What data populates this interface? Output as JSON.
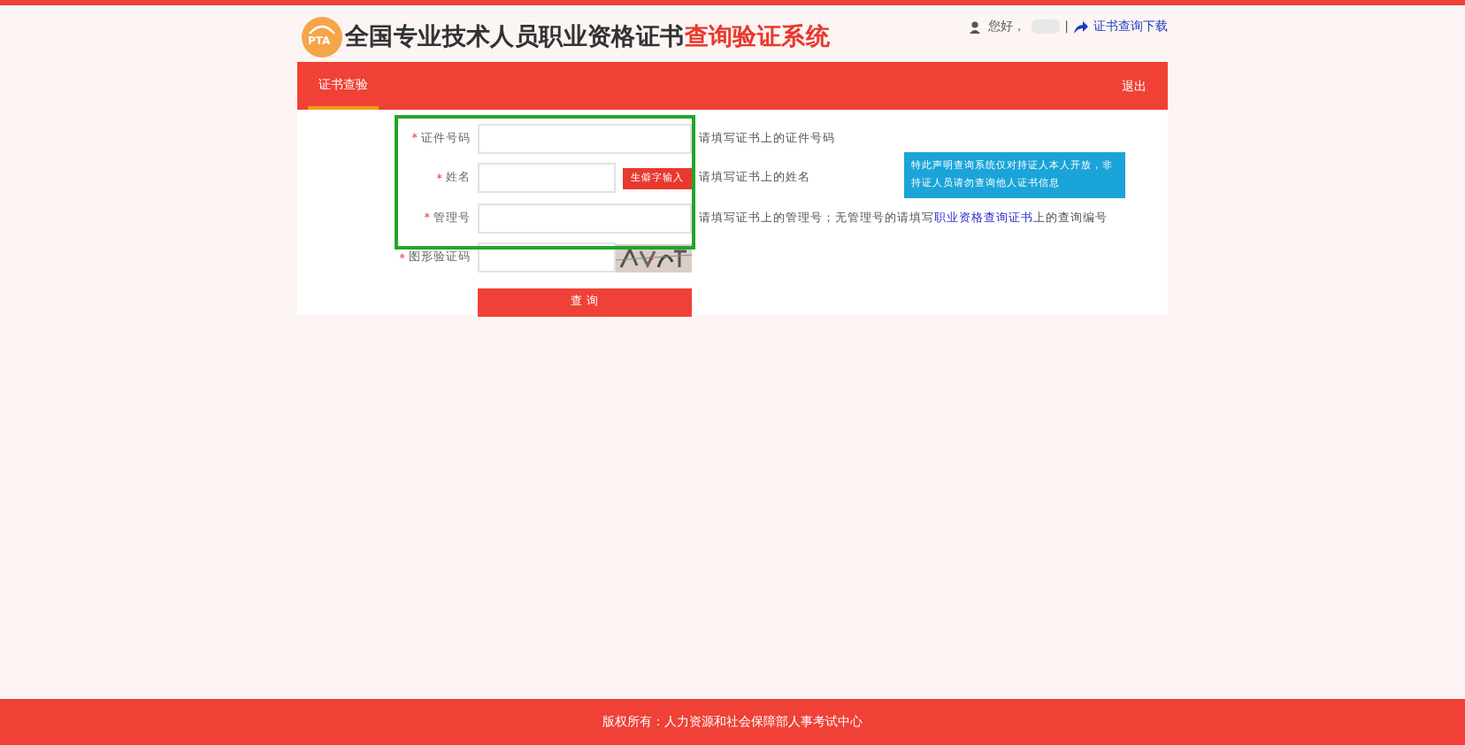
{
  "header": {
    "logo_text": "PTA",
    "title": "全国专业技术人员职业资格证书",
    "title_accent": "查询验证系统",
    "greeting": "您好，",
    "separator": "|",
    "link": "证书查询下载"
  },
  "nav": {
    "tabs": [
      {
        "label": "证书查验",
        "selected": true
      }
    ],
    "logout": "退出"
  },
  "form": {
    "highlighted_fields": [
      {
        "kind": "text",
        "mark": "*",
        "label": "证件号码",
        "hint": "请填写证书上的证件号码"
      },
      {
        "kind": "button",
        "mark": "*",
        "label": "姓名",
        "hint": "请填写证书上的姓名",
        "button": "生僻字输入"
      },
      {
        "kind": "text",
        "mark": "*",
        "label": "管理号",
        "hint": "请填写证书上的管理号；无管理号的请填写",
        "hint_link": "职业资格查询证书",
        "hint_after": "上的查询编号"
      }
    ],
    "fields": [
      {
        "kind": "captcha",
        "mark": "*",
        "label": "图形验证码"
      }
    ],
    "submit": "查 询",
    "tooltip": "特此声明查询系统仅对持证人本人开放，非持证人员请勿查询他人证书信息"
  },
  "footer": "版权所有：人力资源和社会保障部人事考试中心"
}
